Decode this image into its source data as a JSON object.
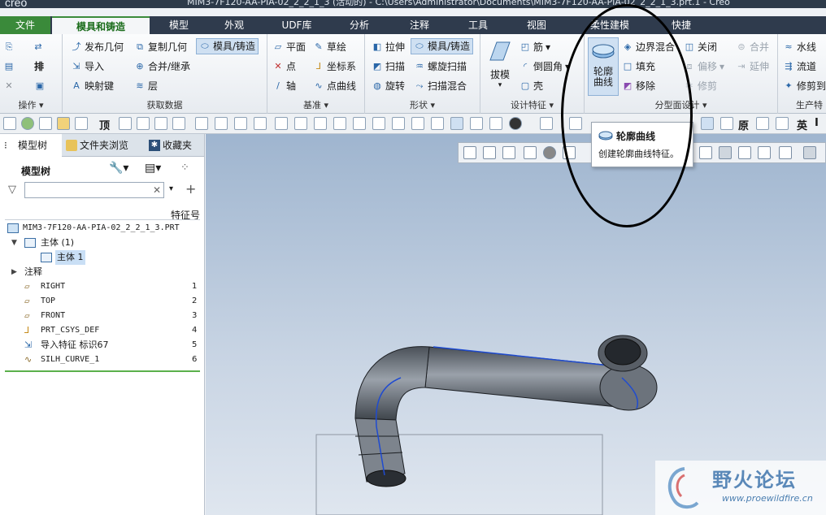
{
  "window": {
    "logo": "creo",
    "title": "MIM3-7F120-AA-PIA-02_2_2_1_3 (活动的) - C:\\Users\\Administrator\\Documents\\MIM3-7F120-AA-PIA-02_2_2_1_3.prt.1 - Creo"
  },
  "tabs": [
    {
      "label": "文件"
    },
    {
      "label": "模具和铸造"
    },
    {
      "label": "模型"
    },
    {
      "label": "外观"
    },
    {
      "label": "UDF库"
    },
    {
      "label": "分析"
    },
    {
      "label": "注释"
    },
    {
      "label": "工具"
    },
    {
      "label": "视图"
    },
    {
      "label": "柔性建模"
    },
    {
      "label": "快捷"
    }
  ],
  "ribbon": {
    "ops": {
      "label": "操作",
      "items": [
        "排"
      ]
    },
    "get_data": {
      "label": "获取数据",
      "items": [
        "发布几何",
        "导入",
        "映射键",
        "复制几何",
        "合并/继承",
        "层",
        "模具/铸造"
      ]
    },
    "datum": {
      "label": "基准",
      "items": [
        "平面",
        "点",
        "轴",
        "草绘",
        "坐标系",
        "点曲线"
      ]
    },
    "shape": {
      "label": "形状",
      "items": [
        "拉伸",
        "扫描",
        "旋转",
        "模具/铸造",
        "螺旋扫描",
        "扫描混合"
      ]
    },
    "design_feature": {
      "label": "设计特征",
      "big": "拔模",
      "items": [
        "筋",
        "倒圆角",
        "壳"
      ]
    },
    "parting": {
      "label": "分型面设计",
      "big": "轮廓曲线",
      "items": [
        "边界混合",
        "填充",
        "移除",
        "关闭",
        "偏移",
        "修剪",
        "合并",
        "延伸"
      ]
    },
    "prod": {
      "label": "生产特",
      "items": [
        "水线",
        "流道",
        "修剪到"
      ]
    }
  },
  "toolbar": {
    "text_items": [
      "顶",
      "原",
      "英"
    ]
  },
  "model_tree": {
    "tabs": [
      "模型树",
      "文件夹浏览",
      "收藏夹"
    ],
    "title": "模型树",
    "col_feature_no": "特征号",
    "items": [
      {
        "name": "MIM3-7F120-AA-PIA-02_2_2_1_3.PRT",
        "num": "",
        "indent": 0
      },
      {
        "name": "主体 (1)",
        "num": "",
        "indent": 1
      },
      {
        "name": "主体 1",
        "num": "",
        "indent": 2
      },
      {
        "name": "注释",
        "num": "",
        "indent": 1
      },
      {
        "name": "RIGHT",
        "num": "1",
        "indent": 1
      },
      {
        "name": "TOP",
        "num": "2",
        "indent": 1
      },
      {
        "name": "FRONT",
        "num": "3",
        "indent": 1
      },
      {
        "name": "PRT_CSYS_DEF",
        "num": "4",
        "indent": 1
      },
      {
        "name": "导入特征 标识67",
        "num": "5",
        "indent": 1
      },
      {
        "name": "SILH_CURVE_1",
        "num": "6",
        "indent": 1
      }
    ]
  },
  "tooltip": {
    "title": "轮廓曲线",
    "desc": "创建轮廓曲线特征。"
  },
  "watermark": {
    "cn": "野火论坛",
    "url": "www.proewildfire.cn"
  },
  "colors": {
    "accent_green": "#3a8a3a",
    "tab_bar": "#2f3b4d",
    "selection": "#cfe0f2"
  }
}
